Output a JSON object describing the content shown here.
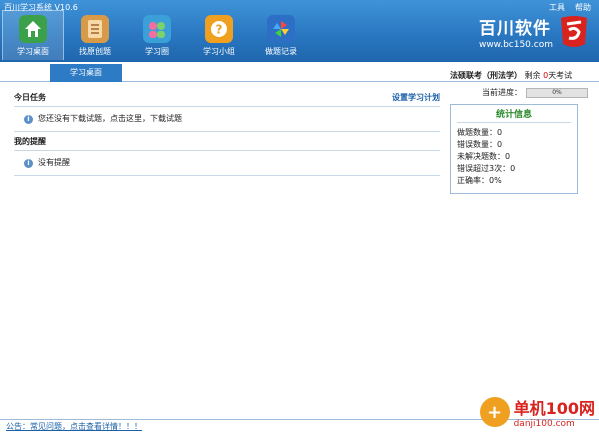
{
  "window": {
    "title": "百川学习系统 V10.6"
  },
  "top_links": [
    "工具",
    "帮助"
  ],
  "nav": {
    "items": [
      {
        "label": "学习桌面",
        "icon": "home-icon",
        "color": "#3aa04a",
        "active": true
      },
      {
        "label": "找原创题",
        "icon": "notebook-icon",
        "color": "#d89a48",
        "active": false
      },
      {
        "label": "学习圈",
        "icon": "people-icon",
        "color": "#3b9fd8",
        "active": false
      },
      {
        "label": "学习小组",
        "icon": "question-icon",
        "color": "#f0a020",
        "active": false
      },
      {
        "label": "做题记录",
        "icon": "pinwheel-icon",
        "color": "#2d6fc4",
        "active": false
      }
    ]
  },
  "brand": {
    "name": "百川软件",
    "url": "www.bc150.com"
  },
  "tabs": {
    "desk_label": "学习桌面"
  },
  "today": {
    "title": "今日任务",
    "plan_link": "设置学习计划",
    "message": "您还没有下载试题，点击这里，下载试题"
  },
  "reminder": {
    "title": "我的提醒",
    "message": "没有提醒"
  },
  "exam": {
    "name": "法硕联考（刑法学）",
    "remaining_prefix": "剩余",
    "days": "0",
    "remaining_suffix": "天考试",
    "progress_label": "当前进度：",
    "progress_text": "0%",
    "progress_value": 0
  },
  "stats": {
    "title": "统计信息",
    "lines": [
      "做题数量：0",
      "错误数量：0",
      "未解决题数：0",
      "错误超过3次：0",
      "正确率：0%"
    ]
  },
  "notice": {
    "text": "公告：常见问题，点击查看详情！！！"
  },
  "watermark": {
    "text": "单机100网",
    "sub": "danji100.com"
  },
  "colors": {
    "title_bar": "#2a78c2",
    "accent": "#1a5fa8",
    "stats_title": "#2a8a2a",
    "days": "#dd0000"
  }
}
